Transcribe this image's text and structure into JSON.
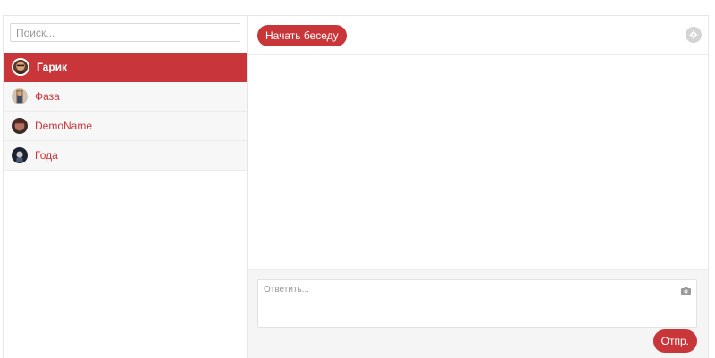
{
  "search": {
    "placeholder": "Поиск..."
  },
  "contacts": [
    {
      "name": "Гарик",
      "active": true,
      "avatar_icon": "user-avatar-icon"
    },
    {
      "name": "Фаза",
      "active": false,
      "avatar_icon": "user-avatar-icon"
    },
    {
      "name": "DemoName",
      "active": false,
      "avatar_icon": "user-avatar-icon"
    },
    {
      "name": "Года",
      "active": false,
      "avatar_icon": "user-avatar-icon"
    }
  ],
  "toolbar": {
    "start_label": "Начать беседу",
    "settings_icon": "gear-icon"
  },
  "composer": {
    "reply_placeholder": "Ответить...",
    "camera_icon": "camera-icon",
    "send_label": "Отпр."
  },
  "colors": {
    "accent": "#c9363a",
    "sidebar_bg": "#f7f7f7",
    "composer_bg": "#f5f5f5"
  }
}
